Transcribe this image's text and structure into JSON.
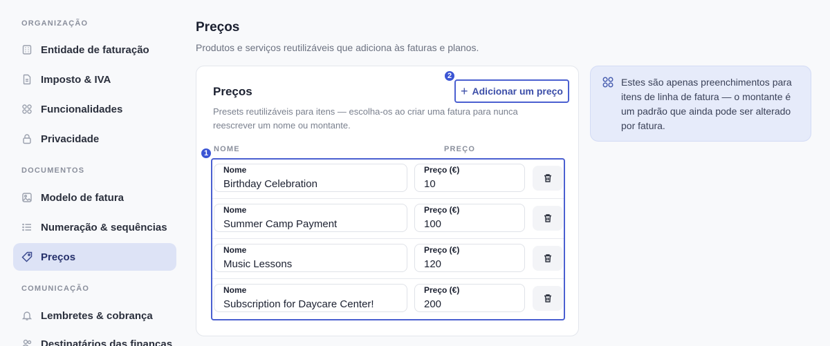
{
  "sidebar": {
    "sections": [
      {
        "label": "ORGANIZAÇÃO"
      },
      {
        "label": "DOCUMENTOS"
      },
      {
        "label": "COMUNICAÇÃO"
      }
    ],
    "items": [
      {
        "label": "Entidade de faturação",
        "icon": "building-icon"
      },
      {
        "label": "Imposto & IVA",
        "icon": "document-icon"
      },
      {
        "label": "Funcionalidades",
        "icon": "grid-icon"
      },
      {
        "label": "Privacidade",
        "icon": "lock-icon"
      },
      {
        "label": "Modelo de fatura",
        "icon": "image-icon"
      },
      {
        "label": "Numeração & sequências",
        "icon": "list-icon"
      },
      {
        "label": "Preços",
        "icon": "tag-icon"
      },
      {
        "label": "Lembretes & cobrança",
        "icon": "bell-icon"
      },
      {
        "label": "Destinatários das finanças",
        "icon": "users-icon"
      }
    ]
  },
  "page": {
    "title": "Preços",
    "subtitle": "Produtos e serviços reutilizáveis que adiciona às faturas e planos."
  },
  "card": {
    "title": "Preços",
    "description": "Presets reutilizáveis para itens — escolha-os ao criar uma fatura para nunca reescrever um nome ou montante.",
    "add_button": "Adicionar um preço",
    "col_name": "NOME",
    "col_price": "PREÇO",
    "rows": [
      {
        "name_label": "Nome",
        "name": "Birthday Celebration",
        "price_label": "Preço (€)",
        "price": "10"
      },
      {
        "name_label": "Nome",
        "name": "Summer Camp Payment",
        "price_label": "Preço (€)",
        "price": "100"
      },
      {
        "name_label": "Nome",
        "name": "Music Lessons",
        "price_label": "Preço (€)",
        "price": "120"
      },
      {
        "name_label": "Nome",
        "name": "Subscription for Daycare Center!",
        "price_label": "Preço (€)",
        "price": "200"
      }
    ]
  },
  "badges": {
    "rows": "1",
    "add": "2"
  },
  "info": {
    "text": "Estes são apenas preenchimentos para itens de linha de fatura — o montante é um padrão que ainda pode ser alterado por fatura."
  },
  "colors": {
    "accent": "#4a5fd0",
    "active_bg": "#dde3f6",
    "info_bg": "#e6ebfa"
  }
}
